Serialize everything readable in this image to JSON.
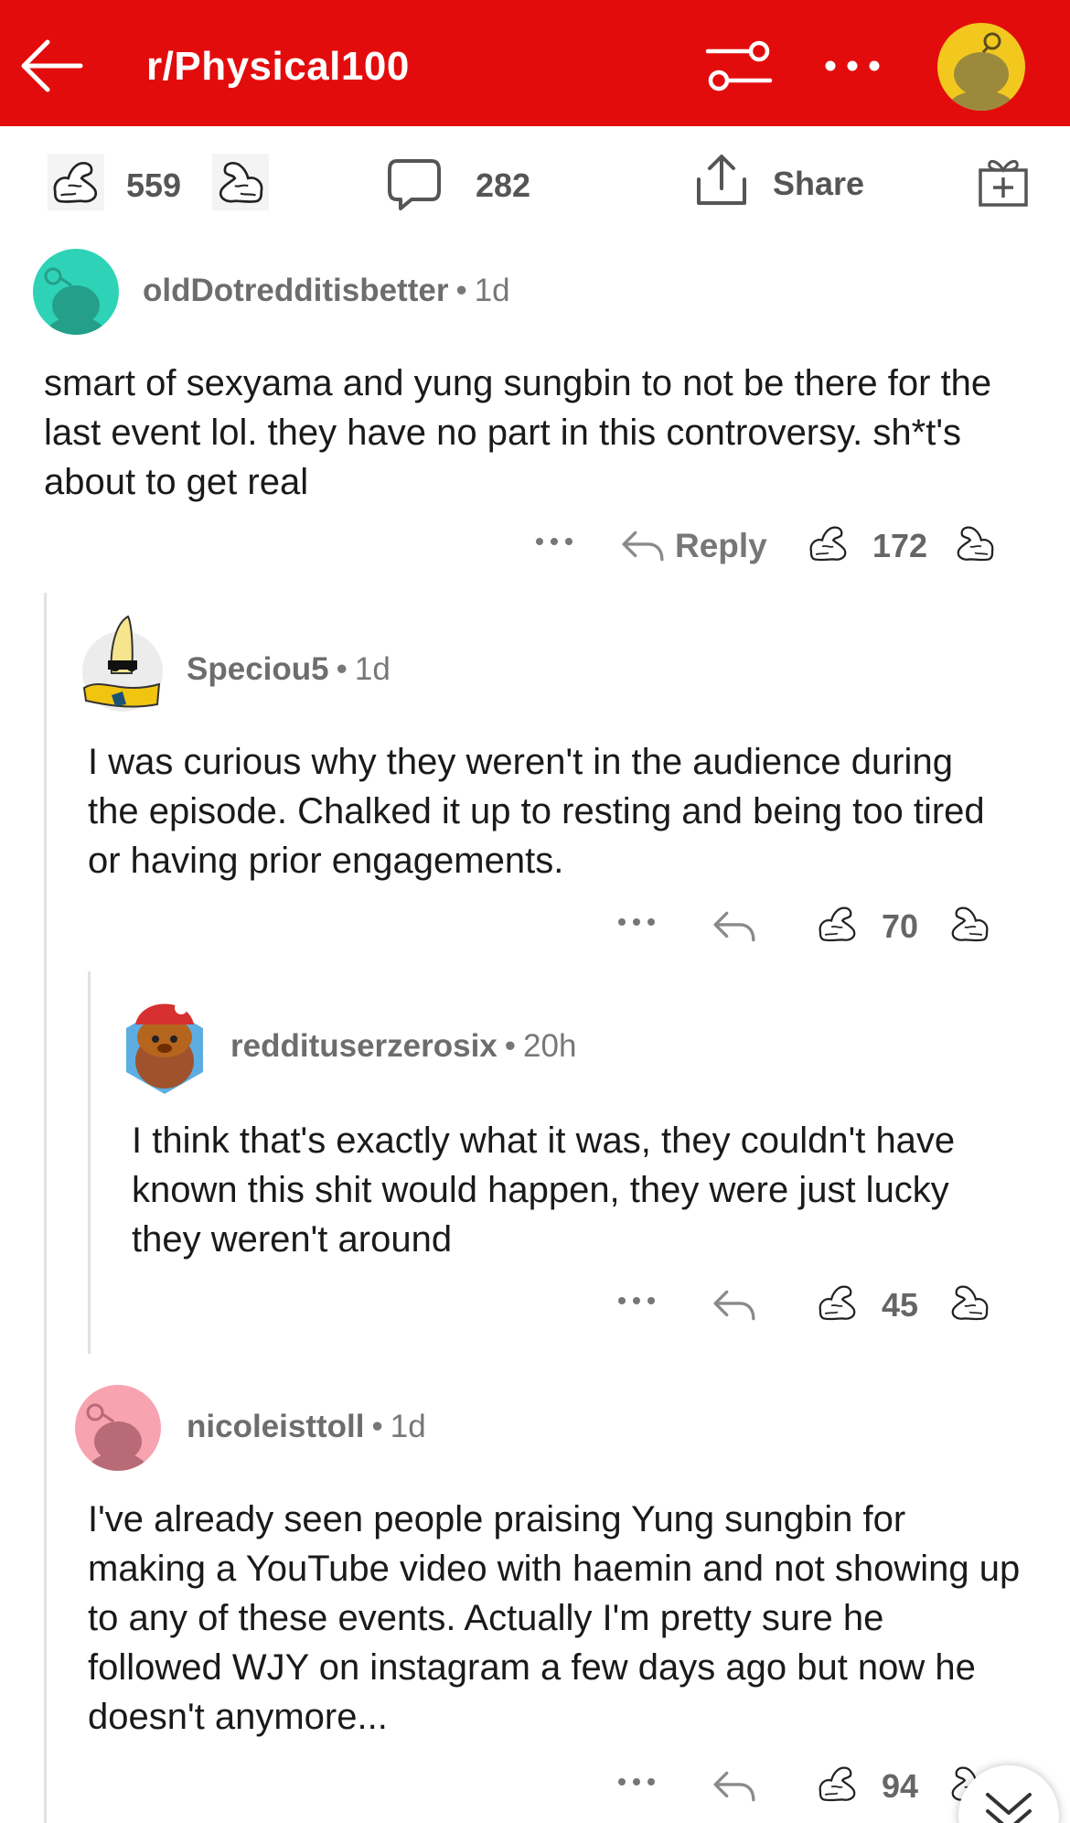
{
  "colors": {
    "header_bg": "#e30c0c",
    "avatar_bg": "#f2c81f"
  },
  "header": {
    "subreddit": "r/Physical100",
    "icons": [
      "back-arrow-icon",
      "filter-sliders-icon",
      "more-horizontal-icon",
      "user-avatar-icon"
    ]
  },
  "post_actions": {
    "upvotes": "559",
    "comments": "282",
    "share_label": "Share",
    "icons": [
      "flexed-arm-upvote-icon",
      "flexed-arm-downvote-icon",
      "comment-bubble-icon",
      "share-upload-icon",
      "award-gift-icon"
    ]
  },
  "comments": [
    {
      "username": "oldDotredditisbetter",
      "age": "1d",
      "body": "smart of sexyama and yung sungbin to not be there for the last event lol. they have no part in this controversy. sh*t's about to get real",
      "reply_label": "Reply",
      "score": "172"
    },
    {
      "username": "Speciou5",
      "age": "1d",
      "body": "I was curious why they weren't in the audience during the episode. Chalked it up to resting and being too tired or having prior engagements.",
      "score": "70"
    },
    {
      "username": "reddituserzerosix",
      "age": "20h",
      "body": "I think that's exactly what it was, they couldn't have known this shit would happen, they were just lucky they weren't around",
      "score": "45"
    },
    {
      "username": "nicoleisttoll",
      "age": "1d",
      "body": "I've already seen people praising Yung sungbin for making a YouTube video with haemin and not showing up to any of these events. Actually I'm pretty sure he followed WJY on instagram a few days ago but now he doesn't anymore...",
      "score": "94"
    }
  ],
  "dot_separator": "•"
}
